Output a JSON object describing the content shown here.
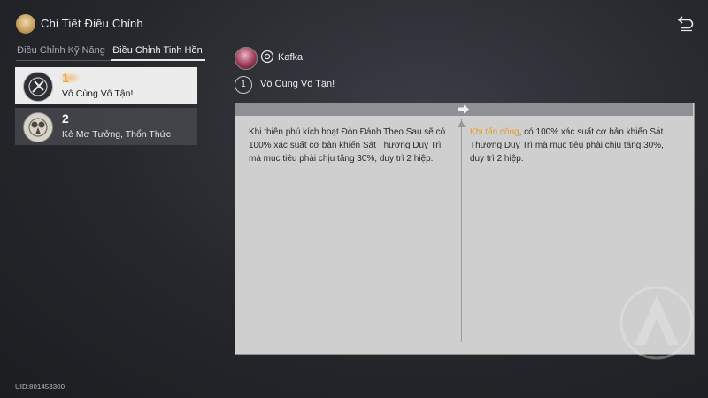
{
  "header": {
    "title": "Chi Tiết Điều Chỉnh",
    "icon": "character-portrait-icon",
    "back_icon": "return-icon"
  },
  "tabs": [
    {
      "label": "Điều Chỉnh Kỹ Năng",
      "active": false
    },
    {
      "label": "Điều Chỉnh Tinh Hồn",
      "active": true
    }
  ],
  "eidolons": [
    {
      "number": "1",
      "name": "Vô Cùng Vô Tận!",
      "selected": true
    },
    {
      "number": "2",
      "name": "Kẻ Mơ Tưởng, Thổn Thức",
      "selected": false
    }
  ],
  "character": {
    "name": "Kafka",
    "path_icon": "nihility-path-icon"
  },
  "detail": {
    "number": "1",
    "name": "Vô Cùng Vô Tận!",
    "old_text": "Khi thiên phú kích hoạt Đòn Đánh Theo Sau sẽ có 100% xác suất cơ bản khiến Sát Thương Duy Trì mà mục tiêu phải chịu tăng 30%, duy trì 2 hiệp.",
    "new_highlight": "Khi tấn công",
    "new_text": ", có 100% xác suất cơ bản khiến Sát Thương Duy Trì mà mục tiêu phải chịu tăng 30%, duy trì 2 hiệp."
  },
  "colors": {
    "highlight": "#e89a2c",
    "selected_number": "#f0a33d"
  },
  "uid": "UID:801453300"
}
